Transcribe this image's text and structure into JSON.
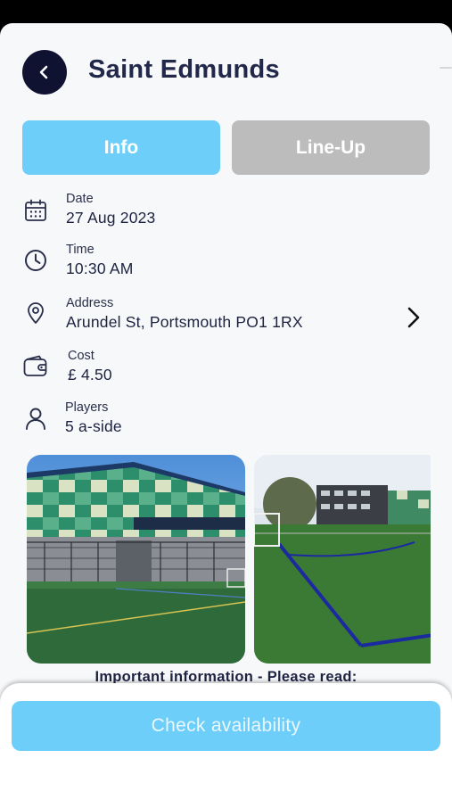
{
  "header": {
    "title": "Saint Edmunds"
  },
  "tabs": [
    {
      "label": "Info",
      "active": true
    },
    {
      "label": "Line-Up",
      "active": false
    }
  ],
  "details": {
    "date": {
      "label": "Date",
      "value": "27 Aug 2023",
      "icon": "calendar-icon"
    },
    "time": {
      "label": "Time",
      "value": "10:30 AM",
      "icon": "clock-icon"
    },
    "address": {
      "label": "Address",
      "value": "Arundel St, Portsmouth PO1 1RX",
      "icon": "location-pin-icon"
    },
    "cost": {
      "label": "Cost",
      "value": "£ 4.50",
      "icon": "wallet-icon"
    },
    "players": {
      "label": "Players",
      "value": "5 a-side",
      "icon": "person-icon"
    }
  },
  "gallery": {
    "photos": [
      "sports-hall-exterior-photo",
      "astroturf-pitch-photo"
    ]
  },
  "important_info": "Important information - Please read:",
  "cta": {
    "label": "Check availability"
  },
  "colors": {
    "accent": "#6dcff9",
    "inactive_tab": "#bcbcbc",
    "back_button": "#101232",
    "title": "#22284a"
  }
}
